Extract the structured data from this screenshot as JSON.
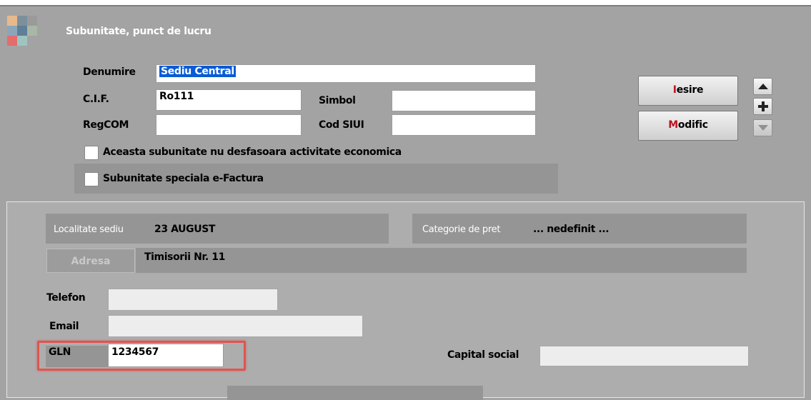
{
  "header": {
    "title": "Subunitate, punct de lucru",
    "logo_icon": "app-tile-icon"
  },
  "form": {
    "denumire_label": "Denumire",
    "denumire_value": "Sediu Central",
    "cif_label": "C.I.F.",
    "cif_value": "Ro111",
    "simbol_label": "Simbol",
    "simbol_value": "",
    "regcom_label": "RegCOM",
    "regcom_value": "",
    "codsiui_label": "Cod SIUI",
    "codsiui_value": "",
    "checkbox_activitate": "Aceasta subunitate nu desfasoara activitate economica",
    "checkbox_efactura": "Subunitate speciala e-Factura"
  },
  "buttons": {
    "iesire_hot": "I",
    "iesire_rest": "esire",
    "modific_hot": "M",
    "modific_rest": "odific",
    "up_icon": "arrow-up-icon",
    "plus_icon": "plus-icon",
    "down_icon": "arrow-down-icon"
  },
  "details": {
    "localitate_label": "Localitate sediu",
    "localitate_value": "23 AUGUST",
    "categorie_label": "Categorie de pret",
    "categorie_value": "... nedefinit ...",
    "adresa_button": "Adresa",
    "adresa_value": "Timisorii Nr. 11",
    "telefon_label": "Telefon",
    "telefon_value": "",
    "email_label": "Email",
    "email_value": "",
    "gln_label": "GLN",
    "gln_value": "1234567",
    "capital_label": "Capital social",
    "capital_value": ""
  },
  "colors": {
    "background": "#a3a3a3",
    "highlight": "#e0544f",
    "selection": "#0a5bd6",
    "hotkey": "#c1121f"
  }
}
